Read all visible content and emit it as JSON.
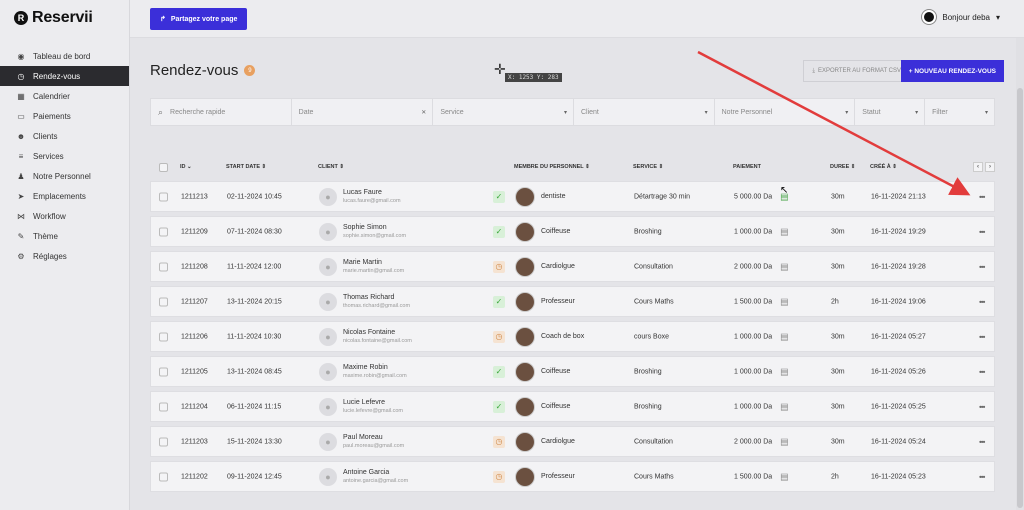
{
  "app": {
    "logo_letter": "R",
    "name": "Reservii"
  },
  "sidebar": {
    "items": [
      {
        "label": "Tableau de bord",
        "icon": "dashboard-icon",
        "glyph": "◉"
      },
      {
        "label": "Rendez-vous",
        "icon": "clock-icon",
        "glyph": "◷",
        "active": true
      },
      {
        "label": "Calendrier",
        "icon": "calendar-icon",
        "glyph": "▦"
      },
      {
        "label": "Paiements",
        "icon": "payment-icon",
        "glyph": "▭"
      },
      {
        "label": "Clients",
        "icon": "users-icon",
        "glyph": "☻"
      },
      {
        "label": "Services",
        "icon": "list-icon",
        "glyph": "≡"
      },
      {
        "label": "Notre Personnel",
        "icon": "person-icon",
        "glyph": "♟"
      },
      {
        "label": "Emplacements",
        "icon": "location-icon",
        "glyph": "➤"
      },
      {
        "label": "Workflow",
        "icon": "workflow-icon",
        "glyph": "⋈"
      },
      {
        "label": "Thème",
        "icon": "brush-icon",
        "glyph": "✎"
      },
      {
        "label": "Réglages",
        "icon": "gear-icon",
        "glyph": "⚙"
      }
    ]
  },
  "topbar": {
    "share_label": "Partagez votre page",
    "greeting": "Bonjour deba"
  },
  "page": {
    "title": "Rendez-vous",
    "count": "9",
    "coord": "X: 1253 Y: 283",
    "export_label": "EXPORTER AU FORMAT CSV",
    "new_label": "+ NOUVEAU RENDEZ-VOUS"
  },
  "filters": {
    "search_placeholder": "Recherche rapide",
    "date": "Date",
    "service": "Service",
    "client": "Client",
    "staff": "Notre Personnel",
    "status": "Statut",
    "filter": "Filter"
  },
  "table": {
    "headers": {
      "id": "ID ⌄",
      "start": "START DATE ⇕",
      "client": "CLIENT ⇕",
      "staff": "MEMBRE DU PERSONNEL ⇕",
      "service": "SERVICE ⇕",
      "payment": "PAIEMENT",
      "duration": "DUREE ⇕",
      "created": "CRÉÉ À ⇕"
    },
    "rows": [
      {
        "id": "1211213",
        "date": "02-11-2024 10:45",
        "name": "Lucas Faure",
        "email": "lucas.faure@gmail.com",
        "status": "ok",
        "staff": "dentiste",
        "service": "Détartrage 30 min",
        "payment": "5 000.00 Da",
        "pay_paid": true,
        "duration": "30m",
        "created": "16-11-2024 21:13"
      },
      {
        "id": "1211209",
        "date": "07-11-2024 08:30",
        "name": "Sophie Simon",
        "email": "sophie.simon@gmail.com",
        "status": "ok",
        "staff": "Coiffeuse",
        "service": "Broshing",
        "payment": "1 000.00 Da",
        "pay_paid": false,
        "duration": "30m",
        "created": "16-11-2024 19:29"
      },
      {
        "id": "1211208",
        "date": "11-11-2024 12:00",
        "name": "Marie Martin",
        "email": "marie.martin@gmail.com",
        "status": "pending",
        "staff": "Cardiolgue",
        "service": "Consultation",
        "payment": "2 000.00 Da",
        "pay_paid": false,
        "duration": "30m",
        "created": "16-11-2024 19:28"
      },
      {
        "id": "1211207",
        "date": "13-11-2024 20:15",
        "name": "Thomas Richard",
        "email": "thomas.richard@gmail.com",
        "status": "ok",
        "staff": "Professeur",
        "service": "Cours Maths",
        "payment": "1 500.00 Da",
        "pay_paid": false,
        "duration": "2h",
        "created": "16-11-2024 19:06"
      },
      {
        "id": "1211206",
        "date": "11-11-2024 10:30",
        "name": "Nicolas Fontaine",
        "email": "nicolas.fontaine@gmail.com",
        "status": "pending",
        "staff": "Coach de box",
        "service": "cours Boxe",
        "payment": "1 000.00 Da",
        "pay_paid": false,
        "duration": "30m",
        "created": "16-11-2024 05:27"
      },
      {
        "id": "1211205",
        "date": "13-11-2024 08:45",
        "name": "Maxime Robin",
        "email": "maxime.robin@gmail.com",
        "status": "ok",
        "staff": "Coiffeuse",
        "service": "Broshing",
        "payment": "1 000.00 Da",
        "pay_paid": false,
        "duration": "30m",
        "created": "16-11-2024 05:26"
      },
      {
        "id": "1211204",
        "date": "06-11-2024 11:15",
        "name": "Lucie Lefevre",
        "email": "lucie.lefevre@gmail.com",
        "status": "ok",
        "staff": "Coiffeuse",
        "service": "Broshing",
        "payment": "1 000.00 Da",
        "pay_paid": false,
        "duration": "30m",
        "created": "16-11-2024 05:25"
      },
      {
        "id": "1211203",
        "date": "15-11-2024 13:30",
        "name": "Paul Moreau",
        "email": "paul.moreau@gmail.com",
        "status": "pending",
        "staff": "Cardiolgue",
        "service": "Consultation",
        "payment": "2 000.00 Da",
        "pay_paid": false,
        "duration": "30m",
        "created": "16-11-2024 05:24"
      },
      {
        "id": "1211202",
        "date": "09-11-2024 12:45",
        "name": "Antoine Garcia",
        "email": "antoine.garcia@gmail.com",
        "status": "pending",
        "staff": "Professeur",
        "service": "Cours Maths",
        "payment": "1 500.00 Da",
        "pay_paid": false,
        "duration": "2h",
        "created": "16-11-2024 05:23"
      }
    ]
  },
  "colors": {
    "accent": "#3b2fd9",
    "annotation": "#e23c3c",
    "sidebar_active": "#2b2b2f"
  }
}
